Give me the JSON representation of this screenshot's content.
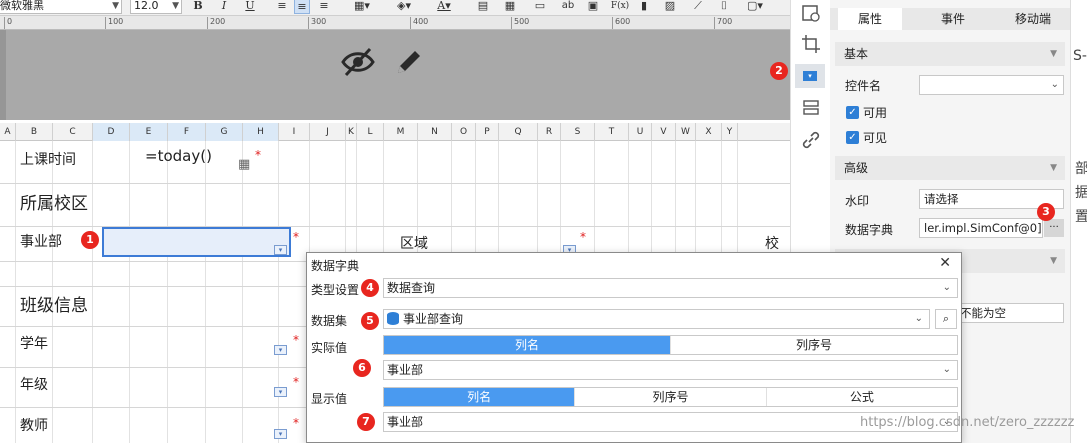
{
  "toolbar": {
    "font_name": "微软雅黑",
    "font_size": "12.0",
    "bold_label": "B",
    "italic_label": "I",
    "underline_label": "U",
    "text_tool_label": "ab",
    "formula_tool_label": "F(x)"
  },
  "ruler": {
    "ticks": [
      "0",
      "100",
      "200",
      "300",
      "400",
      "500",
      "600",
      "700"
    ]
  },
  "preview": {
    "icons": [
      "eye-off-icon",
      "pencil-icon"
    ]
  },
  "columns": [
    "A",
    "B",
    "C",
    "D",
    "E",
    "F",
    "G",
    "H",
    "I",
    "J",
    "K",
    "L",
    "M",
    "N",
    "O",
    "P",
    "Q",
    "R",
    "S",
    "T",
    "U",
    "V",
    "W",
    "X",
    "Y"
  ],
  "grid": {
    "rows": [
      {
        "label": "上课时间",
        "value": "=today()"
      },
      {
        "label": "所属校区"
      },
      {
        "label": "事业部",
        "mid_label": "区域",
        "right_partial": "校"
      },
      {
        "label": "班级信息"
      },
      {
        "label": "学年"
      },
      {
        "label": "年级"
      },
      {
        "label": "教师"
      }
    ],
    "required_mark": "*"
  },
  "badges": {
    "b1": "1",
    "b2": "2",
    "b3": "3",
    "b4": "4",
    "b5": "5",
    "b6": "6",
    "b7": "7"
  },
  "right_panel": {
    "tabs": [
      "属性",
      "事件",
      "移动端"
    ],
    "section_basic": "基本",
    "widget_name_label": "控件名",
    "widget_name_value": "",
    "enabled_label": "可用",
    "visible_label": "可见",
    "section_advanced": "高级",
    "watermark_label": "水印",
    "watermark_value": "请选择",
    "dict_label": "数据字典",
    "dict_value": "ler.impl.SimConf@0]]",
    "dict_more": "···",
    "hidden_value": "不能为空"
  },
  "far_right": {
    "partial_text": [
      "S-",
      "部",
      "据",
      "置"
    ]
  },
  "dialog": {
    "title": "数据字典",
    "close_label": "✕",
    "type_label": "类型设置",
    "type_value": "数据查询",
    "dataset_label": "数据集",
    "dataset_value": "事业部查询",
    "actual_label": "实际值",
    "actual_tabs": [
      "列名",
      "列序号"
    ],
    "actual_value": "事业部",
    "display_label": "显示值",
    "display_tabs": [
      "列名",
      "列序号",
      "公式"
    ],
    "display_value": "事业部"
  },
  "watermark_text": "https://blog.csdn.net/zero_zzzzzz",
  "colors": {
    "badge": "#e8261f",
    "segment_active": "#4a9af0",
    "checkbox": "#2e7fd6",
    "selected_cell": "#e6eefa",
    "selected_border": "#3d7bd6"
  }
}
